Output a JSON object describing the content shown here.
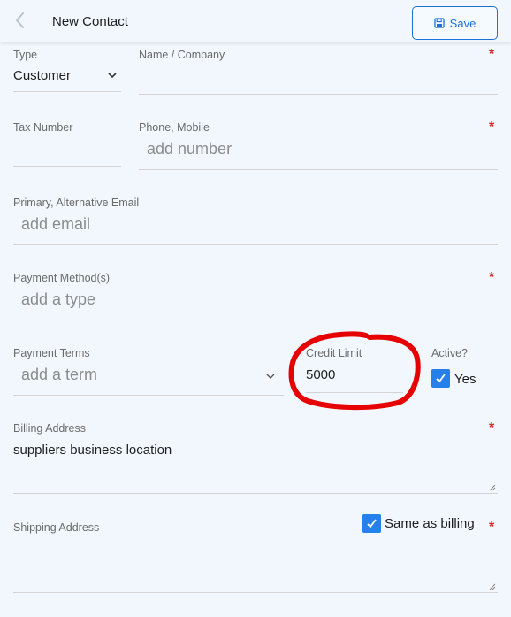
{
  "header": {
    "title_first": "N",
    "title_rest": "ew Contact",
    "save_label": "Save"
  },
  "form": {
    "type": {
      "label": "Type",
      "value": "Customer"
    },
    "name": {
      "label": "Name / Company",
      "value": ""
    },
    "tax_number": {
      "label": "Tax Number",
      "value": ""
    },
    "phone": {
      "label": "Phone, Mobile",
      "placeholder": "add number"
    },
    "email": {
      "label": "Primary, Alternative Email",
      "placeholder": "add email"
    },
    "payment_method": {
      "label": "Payment Method(s)",
      "placeholder": "add a type"
    },
    "payment_terms": {
      "label": "Payment Terms",
      "placeholder": "add a term"
    },
    "credit_limit": {
      "label": "Credit Limit",
      "value": "5000"
    },
    "active": {
      "label": "Active?",
      "checkbox_label": "Yes",
      "checked": true
    },
    "billing_address": {
      "label": "Billing Address",
      "value": "suppliers business location"
    },
    "shipping_address": {
      "label": "Shipping Address",
      "same_as_billing_label": "Same as billing",
      "same_as_billing_checked": true
    }
  },
  "required_marker": "*",
  "colors": {
    "accent": "#2680eb",
    "annotation": "#e60000",
    "required": "#d22b2b"
  },
  "icons": {
    "back": "chevron-left-icon",
    "save": "floppy-disk-icon",
    "dropdown": "chevron-down-icon",
    "check": "checkmark-icon"
  }
}
